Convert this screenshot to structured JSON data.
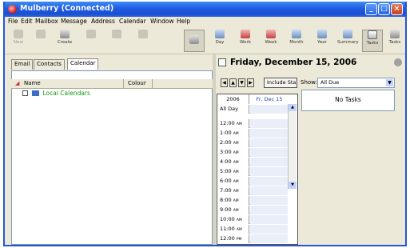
{
  "window": {
    "title": "Mulberry (Connected)"
  },
  "caption_buttons": {
    "minimize": "_",
    "maximize": "□",
    "close": "×"
  },
  "menu": [
    "File",
    "Edit",
    "Mailbox",
    "Message",
    "Address",
    "Calendar",
    "Window",
    "Help"
  ],
  "toolbar": {
    "left": [
      "New",
      "",
      "Create",
      "",
      "",
      ""
    ],
    "right": [
      "Day",
      "Work",
      "Week",
      "Month",
      "Year",
      "Summary",
      "Tasks",
      "Tasks"
    ]
  },
  "tabs": [
    "Email",
    "Contacts",
    "Calendar"
  ],
  "tree": {
    "headers": {
      "name": "Name",
      "colour": "Colour"
    },
    "items": [
      {
        "label": "Local Calendars"
      }
    ]
  },
  "day_header": {
    "title": "Friday, December 15, 2006"
  },
  "controls": {
    "nav": [
      "◀",
      "▲",
      "▼",
      "▶"
    ],
    "include_button": "Include Sta",
    "show_label": "Show:",
    "show_value": "All Due",
    "dropdown_arrow": "▼"
  },
  "tasks": {
    "empty_text": "No Tasks"
  },
  "day_view": {
    "year": "2006",
    "date": "Fr, Dec 15",
    "all_day": "All Day",
    "scroll_up": "▲",
    "scroll_down": "▼",
    "times": [
      {
        "h": "12:00",
        "ap": "AM"
      },
      {
        "h": "1:00",
        "ap": "AM"
      },
      {
        "h": "2:00",
        "ap": "AM"
      },
      {
        "h": "3:00",
        "ap": "AM"
      },
      {
        "h": "4:00",
        "ap": "AM"
      },
      {
        "h": "5:00",
        "ap": "AM"
      },
      {
        "h": "6:00",
        "ap": "AM"
      },
      {
        "h": "7:00",
        "ap": "AM"
      },
      {
        "h": "8:00",
        "ap": "AM"
      },
      {
        "h": "9:00",
        "ap": "AM"
      },
      {
        "h": "10:00",
        "ap": "AM"
      },
      {
        "h": "11:00",
        "ap": "AM"
      },
      {
        "h": "12:00",
        "ap": "PM"
      }
    ]
  }
}
